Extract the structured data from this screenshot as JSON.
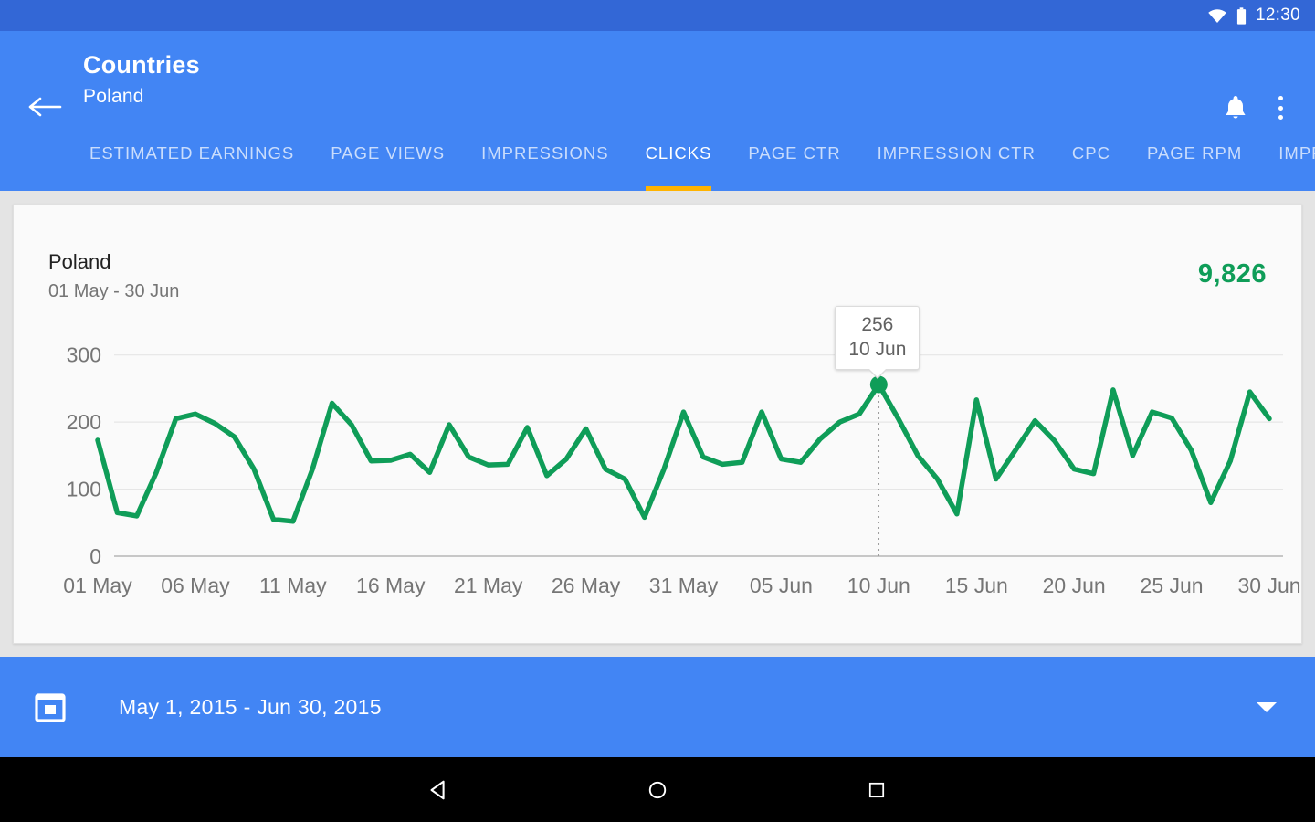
{
  "status_bar": {
    "time": "12:30",
    "icons": [
      "wifi-icon",
      "battery-icon"
    ]
  },
  "app_bar": {
    "back_icon": "back-arrow-icon",
    "title": "Countries",
    "subtitle": "Poland",
    "notifications_icon": "bell-icon",
    "overflow_icon": "overflow-menu-icon",
    "accent_color": "#4285f4",
    "tab_indicator_color": "#ffb300",
    "tabs": [
      {
        "label": "ESTIMATED EARNINGS",
        "active": false
      },
      {
        "label": "PAGE VIEWS",
        "active": false
      },
      {
        "label": "IMPRESSIONS",
        "active": false
      },
      {
        "label": "CLICKS",
        "active": true
      },
      {
        "label": "PAGE CTR",
        "active": false
      },
      {
        "label": "IMPRESSION CTR",
        "active": false
      },
      {
        "label": "CPC",
        "active": false
      },
      {
        "label": "PAGE RPM",
        "active": false
      },
      {
        "label": "IMPRESSION RPM",
        "active": false
      }
    ]
  },
  "card": {
    "country": "Poland",
    "range": "01 May - 30 Jun",
    "total": "9,826",
    "total_color": "#0f9d58"
  },
  "tooltip": {
    "value": "256",
    "date": "10 Jun"
  },
  "date_bar": {
    "calendar_icon": "calendar-icon",
    "range": "May 1, 2015 - Jun 30, 2015",
    "caret_icon": "chevron-down-icon"
  },
  "nav_bar": {
    "back": "nav-back-icon",
    "home": "nav-home-icon",
    "recents": "nav-recents-icon"
  },
  "chart_data": {
    "type": "line",
    "title": "Poland",
    "subtitle": "01 May - 30 Jun",
    "xlabel": "",
    "ylabel": "Clicks",
    "ylim": [
      0,
      320
    ],
    "yticks": [
      0,
      100,
      200,
      300
    ],
    "grid": true,
    "legend": false,
    "line_color": "#0f9d58",
    "total": 9826,
    "highlight": {
      "x": "10 Jun",
      "y": 256
    },
    "xticks": [
      "01 May",
      "06 May",
      "11 May",
      "16 May",
      "21 May",
      "26 May",
      "31 May",
      "05 Jun",
      "10 Jun",
      "15 Jun",
      "20 Jun",
      "25 Jun",
      "30 Jun"
    ],
    "x": [
      "01 May",
      "02 May",
      "03 May",
      "04 May",
      "05 May",
      "06 May",
      "07 May",
      "08 May",
      "09 May",
      "10 May",
      "11 May",
      "12 May",
      "13 May",
      "14 May",
      "15 May",
      "16 May",
      "17 May",
      "18 May",
      "19 May",
      "20 May",
      "21 May",
      "22 May",
      "23 May",
      "24 May",
      "25 May",
      "26 May",
      "27 May",
      "28 May",
      "29 May",
      "30 May",
      "31 May",
      "01 Jun",
      "02 Jun",
      "03 Jun",
      "04 Jun",
      "05 Jun",
      "06 Jun",
      "07 Jun",
      "08 Jun",
      "09 Jun",
      "10 Jun",
      "11 Jun",
      "12 Jun",
      "13 Jun",
      "14 Jun",
      "15 Jun",
      "16 Jun",
      "17 Jun",
      "18 Jun",
      "19 Jun",
      "20 Jun",
      "21 Jun",
      "22 Jun",
      "23 Jun",
      "24 Jun",
      "25 Jun",
      "26 Jun",
      "27 Jun",
      "28 Jun",
      "29 Jun",
      "30 Jun"
    ],
    "values": [
      173,
      65,
      60,
      125,
      205,
      212,
      198,
      178,
      130,
      55,
      52,
      130,
      228,
      196,
      142,
      143,
      152,
      125,
      196,
      148,
      136,
      137,
      192,
      120,
      145,
      190,
      130,
      115,
      58,
      130,
      215,
      148,
      137,
      140,
      215,
      145,
      140,
      175,
      200,
      212,
      256,
      205,
      150,
      115,
      63,
      233,
      115,
      158,
      202,
      172,
      130,
      123,
      248,
      150,
      215,
      206,
      158,
      80,
      142,
      245,
      205
    ]
  }
}
